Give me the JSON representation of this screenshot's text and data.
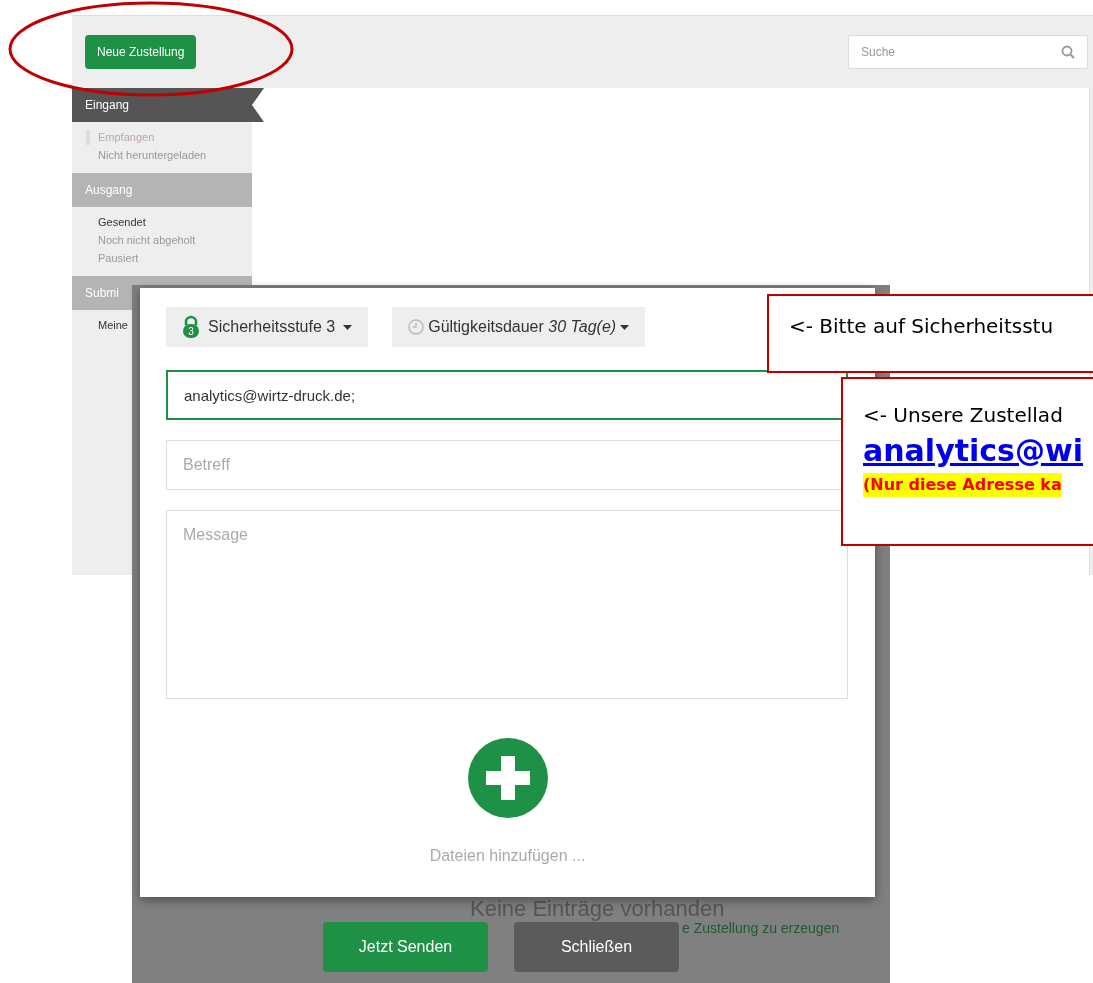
{
  "toolbar": {
    "new_button": "Neue Zustellung",
    "search": {
      "placeholder": "Suche"
    }
  },
  "sidebar": [
    {
      "title": "Eingang",
      "active": true,
      "items": [
        {
          "label": "Empfangen",
          "selected": true,
          "emphasized": false
        },
        {
          "label": "Nicht heruntergeladen",
          "selected": false,
          "emphasized": false
        }
      ]
    },
    {
      "title": "Ausgang",
      "active": false,
      "items": [
        {
          "label": "Gesendet",
          "selected": false,
          "emphasized": true
        },
        {
          "label": "Noch nicht abgeholt",
          "selected": false,
          "emphasized": false
        },
        {
          "label": "Pausiert",
          "selected": false,
          "emphasized": false
        }
      ]
    },
    {
      "title": "Submi",
      "active": false,
      "items": [
        {
          "label": "Meine",
          "selected": false,
          "emphasized": true
        }
      ]
    }
  ],
  "empty_state": {
    "title": "Keine Einträge vorhanden",
    "hint": "e Zustellung zu erzeugen"
  },
  "dialog": {
    "security": {
      "label": "Sicherheitsstufe 3",
      "level_digit": "3"
    },
    "validity": {
      "label": "Gültigkeitsdauer",
      "value": "30 Tag(e)"
    },
    "recipient": {
      "value": "analytics@wirtz-druck.de;",
      "focused": true
    },
    "subject": {
      "placeholder": "Betreff"
    },
    "message": {
      "placeholder": "Message"
    },
    "attach_label": "Dateien hinzufügen ...",
    "buttons": [
      {
        "label": "Jetzt Senden",
        "kind": "primary"
      },
      {
        "label": "Schließen",
        "kind": "secondary"
      }
    ]
  },
  "callouts": [
    {
      "lines": [
        {
          "text": "<-  Bitte auf Sicherheitsstu",
          "kind": "plain"
        }
      ]
    },
    {
      "lines": [
        {
          "text": "<-  Unsere Zustellad",
          "kind": "plain"
        },
        {
          "text": "analytics@wi",
          "kind": "link"
        },
        {
          "text": "(Nur diese Adresse ka",
          "kind": "warning"
        }
      ]
    }
  ]
}
